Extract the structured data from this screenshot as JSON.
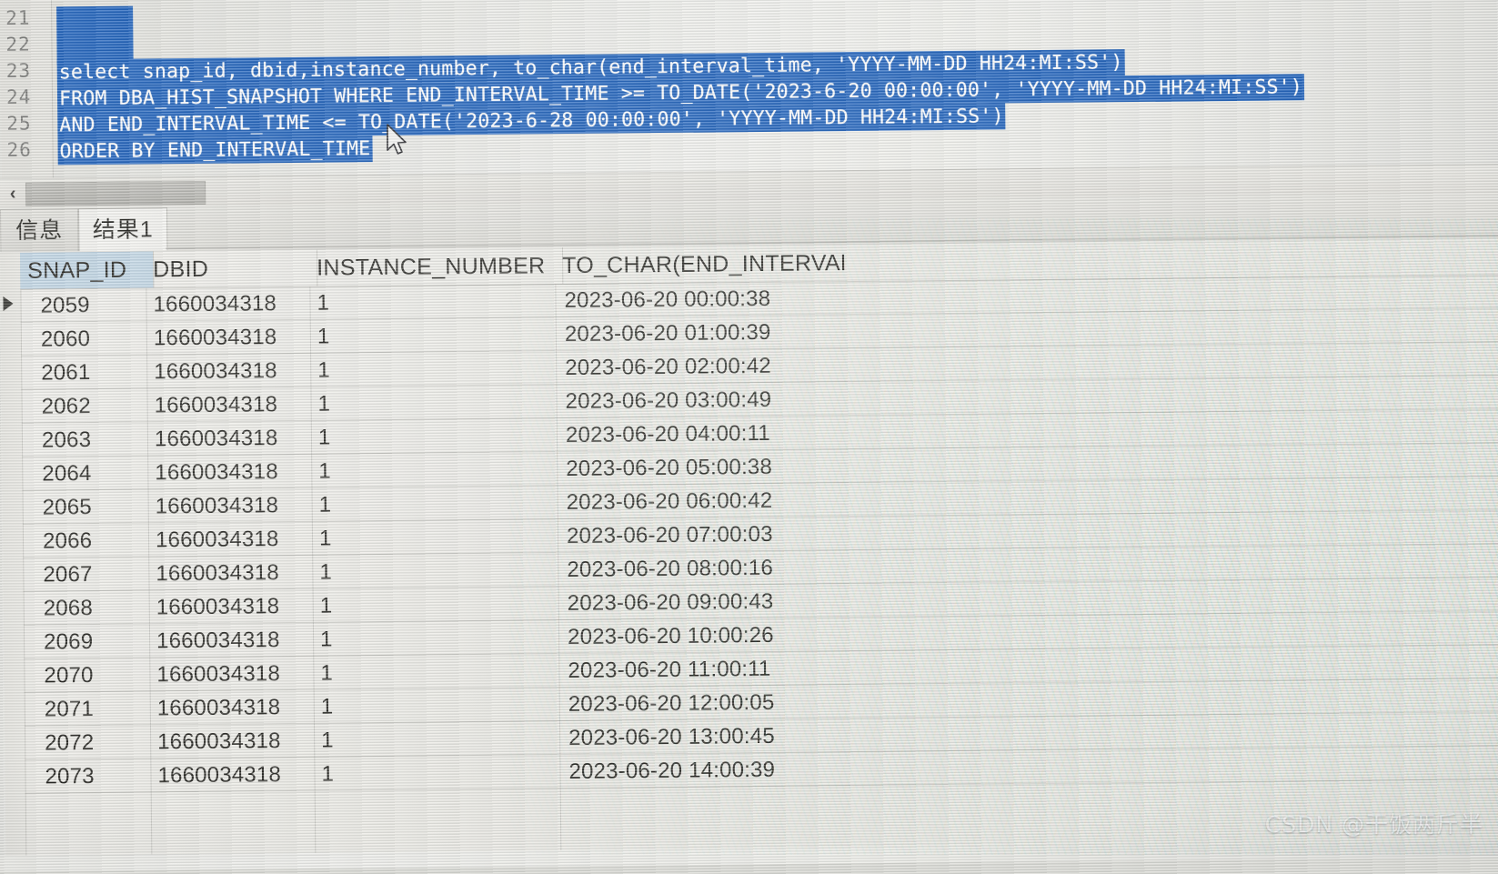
{
  "editor": {
    "line_numbers": [
      "21",
      "22",
      "23",
      "24",
      "25",
      "26"
    ],
    "lines": [
      {
        "no": "21",
        "text": ""
      },
      {
        "no": "22",
        "text": ""
      },
      {
        "no": "23",
        "text": "select snap_id, dbid,instance_number, to_char(end_interval_time, 'YYYY-MM-DD HH24:MI:SS')"
      },
      {
        "no": "24",
        "text": "FROM DBA_HIST_SNAPSHOT WHERE END_INTERVAL_TIME >= TO_DATE('2023-6-20 00:00:00', 'YYYY-MM-DD HH24:MI:SS')"
      },
      {
        "no": "25",
        "text": "AND END_INTERVAL_TIME <= TO_DATE('2023-6-28 00:00:00', 'YYYY-MM-DD HH24:MI:SS')"
      },
      {
        "no": "26",
        "text": "ORDER BY END_INTERVAL_TIME"
      }
    ],
    "selection_color": "#0d55b6",
    "selection_text_color": "#ffffff"
  },
  "scrollbar": {
    "left_arrow": "‹"
  },
  "tabs": [
    {
      "label": "信息",
      "active": false
    },
    {
      "label": "结果1",
      "active": true
    }
  ],
  "grid": {
    "columns": [
      {
        "label": "SNAP_ID",
        "selected": true
      },
      {
        "label": "DBID",
        "selected": false
      },
      {
        "label": "INSTANCE_NUMBER",
        "selected": false
      },
      {
        "label": "TO_CHAR(END_INTERVAL",
        "selected": false
      }
    ],
    "selected_header_color": "#bcd2e2",
    "current_row_index": 0,
    "rows": [
      {
        "snap_id": "2059",
        "dbid": "1660034318",
        "instance_number": "1",
        "end_interval": "2023-06-20 00:00:38"
      },
      {
        "snap_id": "2060",
        "dbid": "1660034318",
        "instance_number": "1",
        "end_interval": "2023-06-20 01:00:39"
      },
      {
        "snap_id": "2061",
        "dbid": "1660034318",
        "instance_number": "1",
        "end_interval": "2023-06-20 02:00:42"
      },
      {
        "snap_id": "2062",
        "dbid": "1660034318",
        "instance_number": "1",
        "end_interval": "2023-06-20 03:00:49"
      },
      {
        "snap_id": "2063",
        "dbid": "1660034318",
        "instance_number": "1",
        "end_interval": "2023-06-20 04:00:11"
      },
      {
        "snap_id": "2064",
        "dbid": "1660034318",
        "instance_number": "1",
        "end_interval": "2023-06-20 05:00:38"
      },
      {
        "snap_id": "2065",
        "dbid": "1660034318",
        "instance_number": "1",
        "end_interval": "2023-06-20 06:00:42"
      },
      {
        "snap_id": "2066",
        "dbid": "1660034318",
        "instance_number": "1",
        "end_interval": "2023-06-20 07:00:03"
      },
      {
        "snap_id": "2067",
        "dbid": "1660034318",
        "instance_number": "1",
        "end_interval": "2023-06-20 08:00:16"
      },
      {
        "snap_id": "2068",
        "dbid": "1660034318",
        "instance_number": "1",
        "end_interval": "2023-06-20 09:00:43"
      },
      {
        "snap_id": "2069",
        "dbid": "1660034318",
        "instance_number": "1",
        "end_interval": "2023-06-20 10:00:26"
      },
      {
        "snap_id": "2070",
        "dbid": "1660034318",
        "instance_number": "1",
        "end_interval": "2023-06-20 11:00:11"
      },
      {
        "snap_id": "2071",
        "dbid": "1660034318",
        "instance_number": "1",
        "end_interval": "2023-06-20 12:00:05"
      },
      {
        "snap_id": "2072",
        "dbid": "1660034318",
        "instance_number": "1",
        "end_interval": "2023-06-20 13:00:45"
      },
      {
        "snap_id": "2073",
        "dbid": "1660034318",
        "instance_number": "1",
        "end_interval": "2023-06-20 14:00:39"
      }
    ]
  },
  "watermark": {
    "text": "CSDN @干饭两斤半"
  }
}
